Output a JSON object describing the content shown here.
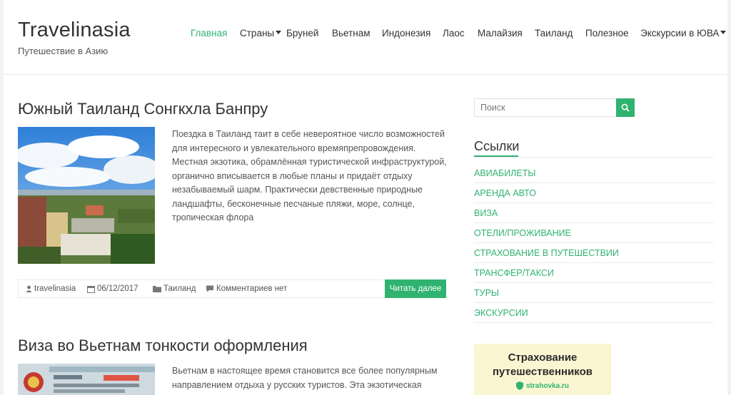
{
  "header": {
    "site_title": "Travelinasia",
    "site_description": "Путешествие в Азию"
  },
  "nav": {
    "items": [
      {
        "label": "Главная",
        "active": true,
        "dropdown": false
      },
      {
        "label": "Страны",
        "active": false,
        "dropdown": true
      },
      {
        "label": "Бруней",
        "active": false,
        "dropdown": false
      },
      {
        "label": "Вьетнам",
        "active": false,
        "dropdown": false
      },
      {
        "label": "Индонезия",
        "active": false,
        "dropdown": false
      },
      {
        "label": "Лаос",
        "active": false,
        "dropdown": false
      },
      {
        "label": "Малайзия",
        "active": false,
        "dropdown": false
      },
      {
        "label": "Таиланд",
        "active": false,
        "dropdown": false
      },
      {
        "label": "Полезное",
        "active": false,
        "dropdown": false
      },
      {
        "label": "Экскурсии в ЮВА",
        "active": false,
        "dropdown": true
      }
    ]
  },
  "posts": [
    {
      "title": "Южный Таиланд Сонгкхла Банпру",
      "excerpt": "Поездка в Таиланд таит в себе невероятное число возможностей для интересного и увлекательного времяпрепровождения. Местная экзотика, обрамлённая туристической инфраструктурой, органично вписывается в любые планы и придаёт отдыху незабываемый шарм. Практически девственные природные ландшафты, бесконечные песчаные пляжи, море, солнце, тропическая флора",
      "author": "travelinasia",
      "date": "06/12/2017",
      "category": "Таиланд",
      "comments": "Комментариев нет",
      "read_more": "Читать далее"
    },
    {
      "title": "Виза во Вьетнам тонкости оформления",
      "excerpt": "Вьетнам в настоящее время становится все более популярным направлением отдыха у русских туристов. Эта экзотическая"
    }
  ],
  "sidebar": {
    "search_placeholder": "Поиск",
    "links_title": "Ссылки",
    "links": [
      "АВИАБИЛЕТЫ",
      "АРЕНДА АВТО",
      "ВИЗА",
      "ОТЕЛИ/ПРОЖИВАНИЕ",
      "СТРАХОВАНИЕ В ПУТЕШЕСТВИИ",
      "ТРАНСФЕР/ТАКСИ",
      "ТУРЫ",
      "ЭКСКУРСИИ"
    ],
    "ad": {
      "line1": "Страхование",
      "line2": "путешественников",
      "logo": "strahovka.ru"
    }
  },
  "colors": {
    "accent": "#30b370"
  }
}
